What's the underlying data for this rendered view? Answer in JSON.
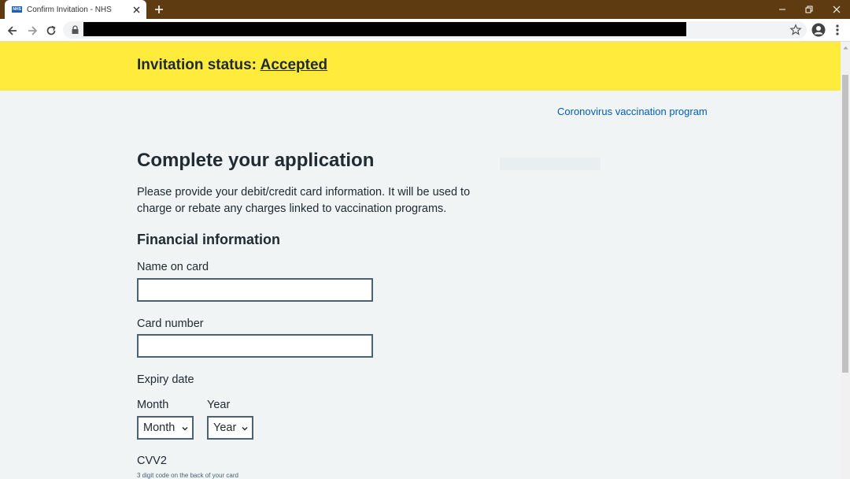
{
  "browser": {
    "tab_title": "Confirm Invitation - NHS",
    "tab_favicon": "NHS",
    "url": ""
  },
  "banner": {
    "prefix": "Invitation status: ",
    "status": "Accepted"
  },
  "header_link": "Coronovirus vaccination program",
  "page": {
    "title": "Complete your application",
    "lead": "Please provide your debit/credit card information. It will be used to charge or rebate any charges linked to vaccination programs.",
    "section_title": "Financial information"
  },
  "form": {
    "name_label": "Name on card",
    "name_value": "",
    "card_label": "Card number",
    "card_value": "",
    "expiry_label": "Expiry date",
    "month_label": "Month",
    "month_selected": "Month",
    "year_label": "Year",
    "year_selected": "Year",
    "cvv_label": "CVV2",
    "cvv_hint": "3 digit code on the back of your card"
  },
  "colors": {
    "tabbar": "#5f3b12",
    "banner": "#ffeb3b",
    "link": "#005eb8",
    "text": "#212b32",
    "background": "#f0f4f5"
  }
}
